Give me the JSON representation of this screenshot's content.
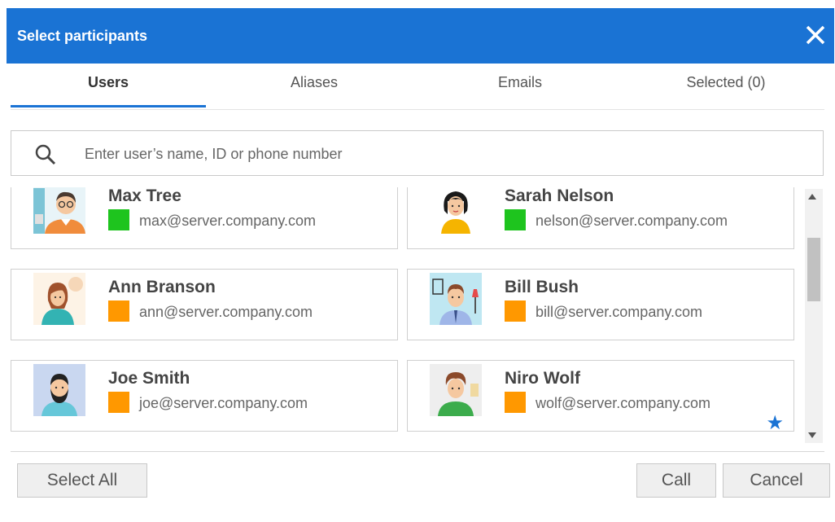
{
  "dialog": {
    "title": "Select participants"
  },
  "tabs": [
    {
      "label": "Users",
      "active": true
    },
    {
      "label": "Aliases",
      "active": false
    },
    {
      "label": "Emails",
      "active": false
    },
    {
      "label": "Selected (0)",
      "active": false
    }
  ],
  "search": {
    "placeholder": "Enter user’s name, ID or phone number",
    "value": ""
  },
  "users": [
    {
      "name": "Max Tree",
      "email": "max@server.company.com",
      "status_color": "#1ec41e",
      "avatar": "man-with-glasses-avatar",
      "favorite": false
    },
    {
      "name": "Sarah Nelson",
      "email": "nelson@server.company.com",
      "status_color": "#1ec41e",
      "avatar": "woman-with-headset-avatar",
      "favorite": false
    },
    {
      "name": "Ann Branson",
      "email": "ann@server.company.com",
      "status_color": "#ff9800",
      "avatar": "woman-avatar",
      "favorite": false
    },
    {
      "name": "Bill Bush",
      "email": "bill@server.company.com",
      "status_color": "#ff9800",
      "avatar": "man-with-tie-avatar",
      "favorite": false
    },
    {
      "name": "Joe Smith",
      "email": "joe@server.company.com",
      "status_color": "#ff9800",
      "avatar": "bearded-man-avatar",
      "favorite": false
    },
    {
      "name": "Niro Wolf",
      "email": "wolf@server.company.com",
      "status_color": "#ff9800",
      "avatar": "man-avatar",
      "favorite": true
    }
  ],
  "buttons": {
    "select_all": "Select All",
    "call": "Call",
    "cancel": "Cancel"
  },
  "colors": {
    "accent": "#1a73d4",
    "online": "#1ec41e",
    "away": "#ff9800"
  }
}
